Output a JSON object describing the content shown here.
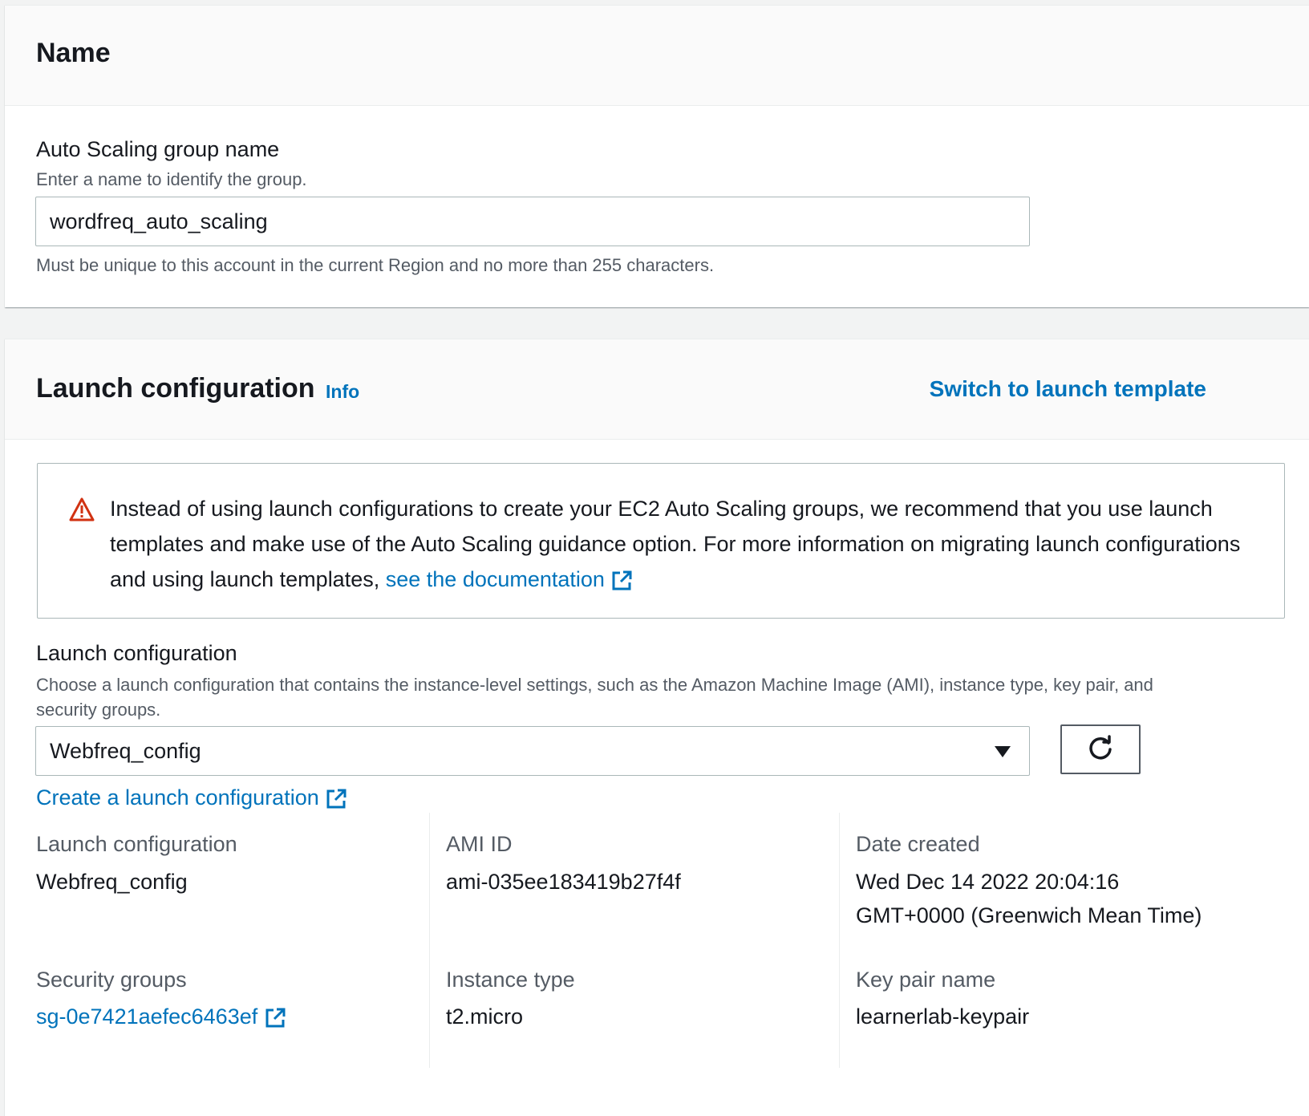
{
  "name_section": {
    "title": "Name",
    "field_label": "Auto Scaling group name",
    "field_description": "Enter a name to identify the group.",
    "field_value": "wordfreq_auto_scaling",
    "field_constraint": "Must be unique to this account in the current Region and no more than 255 characters."
  },
  "launch_section": {
    "title": "Launch configuration",
    "info_link": "Info",
    "switch_link": "Switch to launch template",
    "warning": {
      "text": "Instead of using launch configurations to create your EC2 Auto Scaling groups, we recommend that you use launch templates and make use of the Auto Scaling guidance option. For more information on migrating launch configurations and using launch templates,",
      "link_text": "see the documentation"
    },
    "select_label": "Launch configuration",
    "select_description_line1": "Choose a launch configuration that contains the instance-level settings, such as the Amazon Machine Image (AMI), instance type, key pair, and",
    "select_description_line2": "security groups.",
    "selected_value": "Webfreq_config",
    "create_link": "Create a launch configuration",
    "details": {
      "launch_config_key": "Launch configuration",
      "launch_config_value": "Webfreq_config",
      "ami_key": "AMI ID",
      "ami_value": "ami-035ee183419b27f4f",
      "date_key": "Date created",
      "date_value_line1": "Wed Dec 14 2022 20:04:16",
      "date_value_line2": "GMT+0000 (Greenwich Mean Time)",
      "sg_key": "Security groups",
      "sg_value": "sg-0e7421aefec6463ef",
      "instance_type_key": "Instance type",
      "instance_type_value": "t2.micro",
      "key_pair_key": "Key pair name",
      "key_pair_value": "learnerlab-keypair"
    }
  },
  "colors": {
    "link": "#0073bb",
    "warning_icon": "#d13212",
    "text": "#16191f",
    "secondary_text": "#545b64",
    "border": "#aab7b8"
  },
  "icons": [
    "warning-triangle-icon",
    "external-link-icon",
    "caret-down-icon",
    "refresh-icon"
  ]
}
